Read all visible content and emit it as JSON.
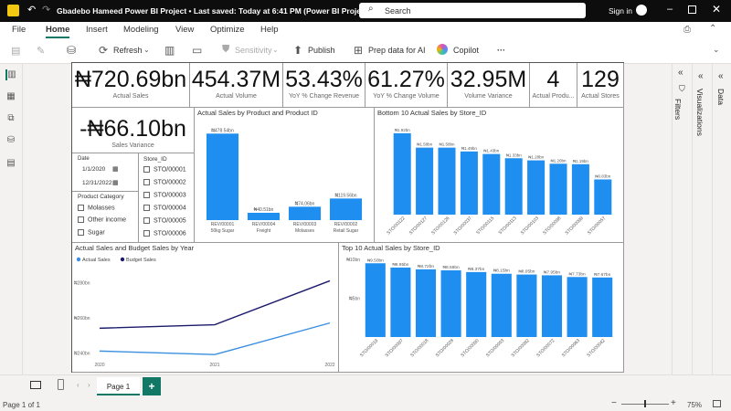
{
  "window": {
    "title": "Gbadebo Hameed Power BI Project • Last saved: Today at 6:41 PM (Power BI Project)",
    "search_placeholder": "Search",
    "signin": "Sign in"
  },
  "menu": [
    "File",
    "Home",
    "Insert",
    "Modeling",
    "View",
    "Optimize",
    "Help"
  ],
  "toolbar": {
    "refresh": "Refresh",
    "sensitivity": "Sensitivity",
    "publish": "Publish",
    "prep": "Prep data for AI",
    "copilot": "Copilot",
    "more": "···"
  },
  "kpis": [
    {
      "value": "₦720.69bn",
      "label": "Actual Sales"
    },
    {
      "value": "454.37M",
      "label": "Actual Volume"
    },
    {
      "value": "53.43%",
      "label": "YoY % Change Revenue"
    },
    {
      "value": "61.27%",
      "label": "YoY % Change Volume"
    },
    {
      "value": "32.95M",
      "label": "Volume Variance"
    },
    {
      "value": "4",
      "label": "Actual Produ..."
    },
    {
      "value": "129",
      "label": "Actual Stores"
    }
  ],
  "sales_variance": {
    "value": "-₦66.10bn",
    "label": "Sales Variance"
  },
  "date_slicer": {
    "title": "Date",
    "start": "1/1/2020",
    "end": "12/31/2022"
  },
  "store_slicer": {
    "title": "Store_ID",
    "items": [
      "STO/00001",
      "STO/00002",
      "STO/00003",
      "STO/00004",
      "STO/00005",
      "STO/00006"
    ]
  },
  "category_slicer": {
    "title": "Product Category",
    "items": [
      "Molasses",
      "Other income",
      "Sugar"
    ]
  },
  "chart_data": [
    {
      "type": "bar",
      "title": "Actual Sales by Product and Product ID",
      "categories": [
        "REV/00001 50kg Sugar",
        "REV/00004 Freight",
        "REV/00003 Molasses",
        "REV/00002 Retail Sugar"
      ],
      "cat_line1": [
        "REV/00001",
        "REV/00004",
        "REV/00003",
        "REV/00002"
      ],
      "cat_line2": [
        "50kg Sugar",
        "Freight",
        "Molasses",
        "Retail Sugar"
      ],
      "labels": [
        "₦478.54bn",
        "₦40.51bn",
        "₦74.06bn",
        "₦119.56bn"
      ],
      "values": [
        478.54,
        40.51,
        74.06,
        119.56
      ]
    },
    {
      "type": "bar",
      "title": "Bottom 10 Actual Sales by Store_ID",
      "categories": [
        "STO/00122",
        "STO/00127",
        "STO/00126",
        "STO/00037",
        "STO/00115",
        "STO/00113",
        "STO/00103",
        "STO/00098",
        "STO/00099",
        "STO/00057"
      ],
      "labels": [
        "₦1.92bn",
        "₦1.58bn",
        "₦1.58bn",
        "₦1.49bn",
        "₦1.43bn",
        "₦1.33bn",
        "₦1.28bn",
        "₦1.20bn",
        "₦1.19bn",
        "₦0.83bn"
      ],
      "values": [
        1.92,
        1.58,
        1.58,
        1.49,
        1.43,
        1.33,
        1.28,
        1.2,
        1.19,
        0.83
      ]
    },
    {
      "type": "line",
      "title": "Actual Sales and Budget Sales by Year",
      "legend": [
        "Actual Sales",
        "Budget Sales"
      ],
      "x": [
        "2020",
        "2021",
        "2022"
      ],
      "yticks": [
        "₦280bn",
        "₦260bn",
        "₦240bn"
      ],
      "series": [
        {
          "name": "Actual Sales",
          "values": [
            241,
            239,
            257
          ],
          "color": "#3a8fe0"
        },
        {
          "name": "Budget Sales",
          "values": [
            254,
            256,
            281
          ],
          "color": "#1c1a6b"
        }
      ],
      "ylim": [
        236,
        288
      ]
    },
    {
      "type": "bar",
      "title": "Top 10 Actual Sales by Store_ID",
      "categories": [
        "STO/00019",
        "STO/00097",
        "STO/00018",
        "STO/00028",
        "STO/00090",
        "STO/00003",
        "STO/00082",
        "STO/00072",
        "STO/00063",
        "STO/00042"
      ],
      "labels": [
        "₦9.50bn",
        "₦8.95bn",
        "₦8.72bn",
        "₦8.59bn",
        "₦8.37bn",
        "₦8.15bn",
        "₦8.05bn",
        "₦7.95bn",
        "₦7.73bn",
        "₦7.67bn"
      ],
      "values": [
        9.5,
        8.95,
        8.72,
        8.59,
        8.37,
        8.15,
        8.05,
        7.95,
        7.73,
        7.67
      ],
      "yticks": [
        "₦10bn",
        "₦5bn"
      ]
    }
  ],
  "panes": {
    "filters": "Filters",
    "visualizations": "Visualizations",
    "data": "Data"
  },
  "pages": {
    "tab": "Page 1",
    "add": "+"
  },
  "status": {
    "page": "Page 1 of 1",
    "zoom": "75%"
  },
  "colors": {
    "bar": "#1f8ef1",
    "titlebar": "#0d0d0d",
    "accent": "#117865"
  }
}
